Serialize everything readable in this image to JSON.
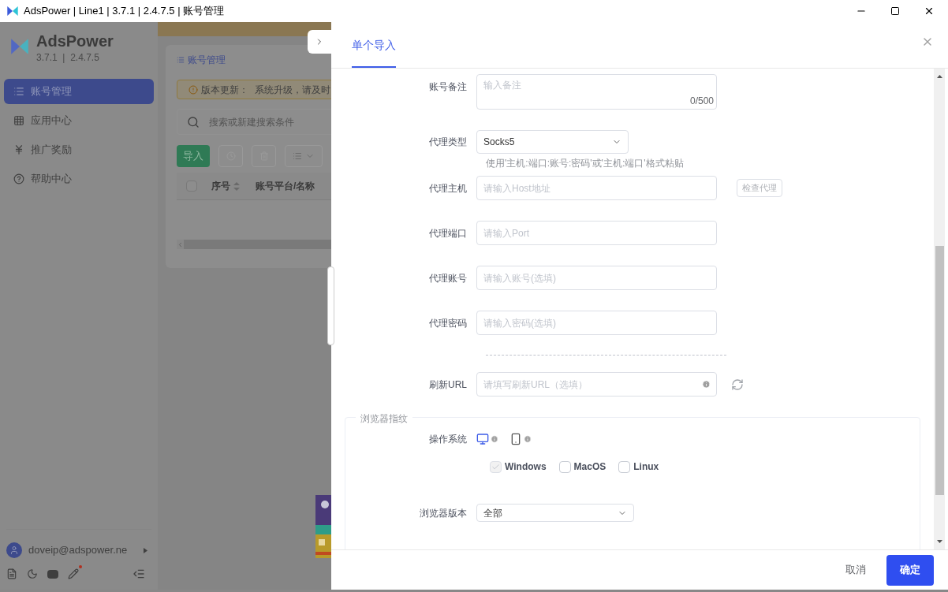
{
  "window": {
    "title": "AdsPower | Line1 | 3.7.1 | 2.4.7.5 | 账号管理"
  },
  "sidebar": {
    "brand": "AdsPower",
    "version": "3.7.1  |  2.4.7.5",
    "items": [
      {
        "label": "账号管理",
        "selected": true
      },
      {
        "label": "应用中心",
        "selected": false
      },
      {
        "label": "推广奖励",
        "selected": false
      },
      {
        "label": "帮助中心",
        "selected": false
      }
    ],
    "user": {
      "email": "doveip@adspower.ne"
    }
  },
  "main": {
    "title": "账号管理",
    "alert": {
      "label": "版本更新：",
      "text": "系统升级，请及时"
    },
    "search": {
      "placeholder": "搜索或新建搜索条件"
    },
    "import_button": "导入",
    "select_all": {
      "checked": false
    },
    "columns": [
      "序号",
      "账号平台/名称"
    ]
  },
  "drawer": {
    "tabs": [
      {
        "label": "单个导入",
        "selected": true
      }
    ],
    "fields": [
      {
        "kind": "textarea",
        "label": "账号备注",
        "placeholder": "输入备注",
        "counter": "0/500"
      },
      {
        "kind": "select",
        "label": "代理类型",
        "value": "Socks5",
        "hint": "使用'主机:端口:账号:密码'或'主机:端口'格式粘贴"
      },
      {
        "kind": "input",
        "label": "代理主机",
        "placeholder": "请输入Host地址",
        "action": "检查代理"
      },
      {
        "kind": "input",
        "label": "代理端口",
        "placeholder": "请输入Port"
      },
      {
        "kind": "input",
        "label": "代理账号",
        "placeholder": "请输入账号(选填)"
      },
      {
        "kind": "input",
        "label": "代理密码",
        "placeholder": "请输入密码(选填)"
      },
      {
        "kind": "divider"
      },
      {
        "kind": "url",
        "label": "刷新URL",
        "placeholder": "请填写刷新URL（选填）"
      }
    ],
    "fingerprint": {
      "legend": "浏览器指纹",
      "os_label": "操作系统",
      "devices": [
        {
          "kind": "desktop",
          "selected": true
        },
        {
          "kind": "mobile",
          "selected": false
        }
      ],
      "systems": [
        {
          "label": "Windows",
          "checked": true,
          "disabled": true
        },
        {
          "label": "MacOS",
          "checked": false,
          "disabled": false
        },
        {
          "label": "Linux",
          "checked": false,
          "disabled": false
        }
      ],
      "browser_label": "浏览器版本",
      "browser_value": "全部"
    },
    "footer": {
      "cancel": "取消",
      "confirm": "确定"
    }
  }
}
